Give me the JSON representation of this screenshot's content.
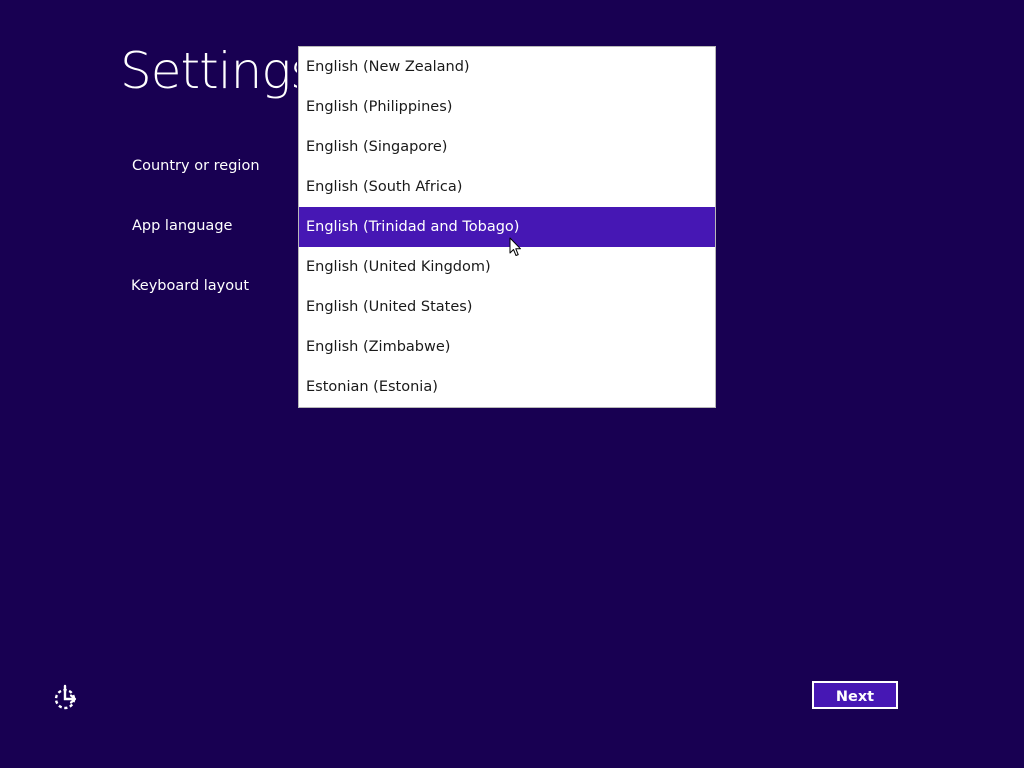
{
  "page": {
    "title": "Settings"
  },
  "fields": {
    "country_label": "Country or region",
    "app_language_label": "App language",
    "keyboard_layout_label": "Keyboard layout"
  },
  "dropdown": {
    "options": [
      {
        "label": "English (New Zealand)"
      },
      {
        "label": "English (Philippines)"
      },
      {
        "label": "English (Singapore)"
      },
      {
        "label": "English (South Africa)"
      },
      {
        "label": "English (Trinidad and Tobago)",
        "selected": true
      },
      {
        "label": "English (United Kingdom)"
      },
      {
        "label": "English (United States)"
      },
      {
        "label": "English (Zimbabwe)"
      },
      {
        "label": "Estonian (Estonia)"
      }
    ]
  },
  "footer": {
    "accessibility_icon": "ease-of-access-icon",
    "next_label": "Next"
  },
  "colors": {
    "background": "#180052",
    "accent": "#4617b4",
    "list_background": "#ffffff",
    "list_text": "#1a1a1a"
  }
}
